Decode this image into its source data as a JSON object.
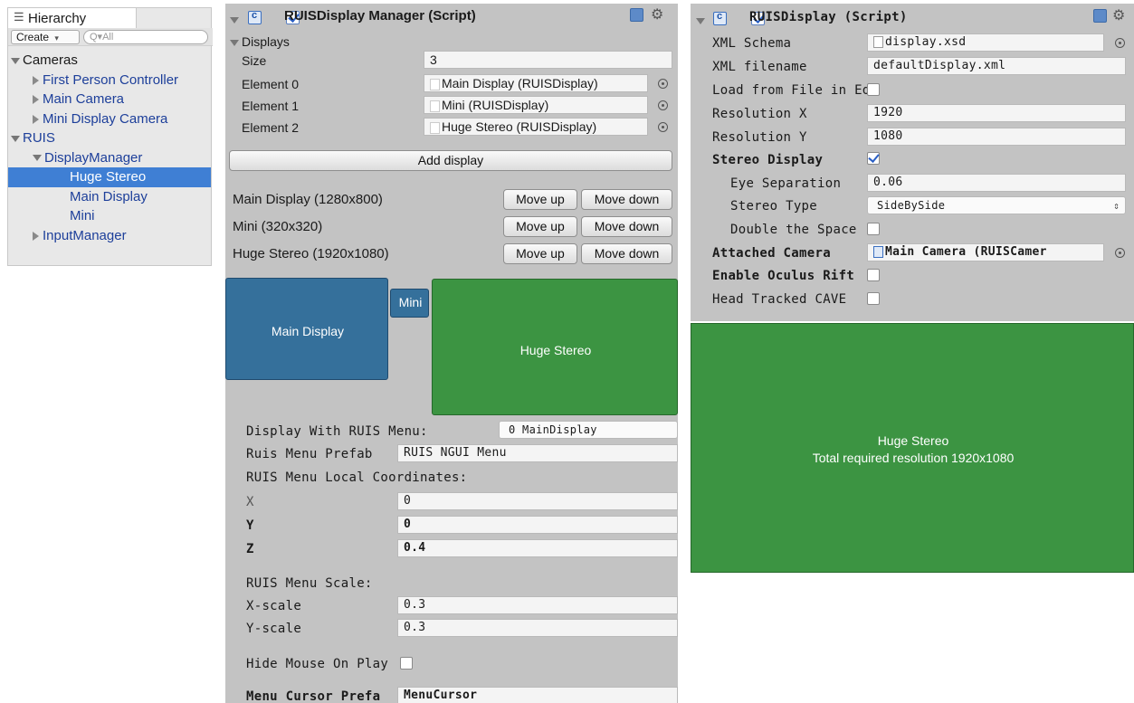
{
  "hierarchy": {
    "tab_label": "Hierarchy",
    "create_label": "Create",
    "search_placeholder": "Q▾All",
    "items": [
      {
        "label": "Cameras",
        "depth": 0,
        "expanded": true
      },
      {
        "label": "First Person Controller",
        "depth": 1,
        "expanded": false
      },
      {
        "label": "Main Camera",
        "depth": 1,
        "expanded": false
      },
      {
        "label": "Mini Display Camera",
        "depth": 1,
        "expanded": false
      },
      {
        "label": "RUIS",
        "depth": 0,
        "expanded": true
      },
      {
        "label": "DisplayManager",
        "depth": 1,
        "expanded": true
      },
      {
        "label": "Huge Stereo",
        "depth": 2,
        "selected": true
      },
      {
        "label": "Main Display",
        "depth": 2
      },
      {
        "label": "Mini",
        "depth": 2
      },
      {
        "label": "InputManager",
        "depth": 1,
        "expanded": false
      }
    ]
  },
  "manager": {
    "title": "RUISDisplay Manager (Script)",
    "displays_label": "Displays",
    "size_label": "Size",
    "size_value": "3",
    "elements": [
      {
        "label": "Element 0",
        "value": "Main Display (RUISDisplay)"
      },
      {
        "label": "Element 1",
        "value": "Mini (RUISDisplay)"
      },
      {
        "label": "Element 2",
        "value": "Huge Stereo (RUISDisplay)"
      }
    ],
    "add_display_label": "Add display",
    "display_rows": [
      {
        "label": "Main Display (1280x800)"
      },
      {
        "label": "Mini (320x320)"
      },
      {
        "label": "Huge Stereo (1920x1080)"
      }
    ],
    "move_up_label": "Move up",
    "move_down_label": "Move down",
    "preview": {
      "main_label": "Main Display",
      "mini_label": "Mini",
      "huge_label": "Huge Stereo",
      "blue_color": "#35709b",
      "green_color": "#3c9442"
    },
    "menu": {
      "display_with_label": "Display With RUIS Menu:",
      "display_with_value": "0 MainDisplay",
      "prefab_label": "Ruis Menu Prefab",
      "prefab_value": "RUIS NGUI Menu",
      "local_coords_label": "RUIS Menu Local Coordinates:",
      "x_label": "X",
      "x_value": "0",
      "y_label": "Y",
      "y_value": "0",
      "z_label": "Z",
      "z_value": "0.4",
      "scale_label": "RUIS Menu Scale:",
      "xscale_label": "X-scale",
      "xscale_value": "0.3",
      "yscale_label": "Y-scale",
      "yscale_value": "0.3",
      "hide_mouse_label": "Hide Mouse On Play",
      "cursor_prefab_label": "Menu Cursor Prefa",
      "cursor_prefab_value": "MenuCursor"
    }
  },
  "display": {
    "title": "RUISDisplay (Script)",
    "xml_schema_label": "XML Schema",
    "xml_schema_value": "display.xsd",
    "xml_filename_label": "XML filename",
    "xml_filename_value": "defaultDisplay.xml",
    "load_from_file_label": "Load from File in Edi",
    "resolution_x_label": "Resolution X",
    "resolution_x_value": "1920",
    "resolution_y_label": "Resolution Y",
    "resolution_y_value": "1080",
    "stereo_display_label": "Stereo Display",
    "eye_separation_label": "Eye Separation",
    "eye_separation_value": "0.06",
    "stereo_type_label": "Stereo Type",
    "stereo_type_value": "SideBySide",
    "double_space_label": "Double the Space",
    "attached_camera_label": "Attached Camera",
    "attached_camera_value": "Main Camera (RUISCamer",
    "enable_oculus_label": "Enable Oculus Rift",
    "head_tracked_label": "Head Tracked CAVE",
    "preview_title": "Huge Stereo",
    "preview_subtitle": "Total required resolution 1920x1080",
    "preview_color": "#3c9442"
  }
}
